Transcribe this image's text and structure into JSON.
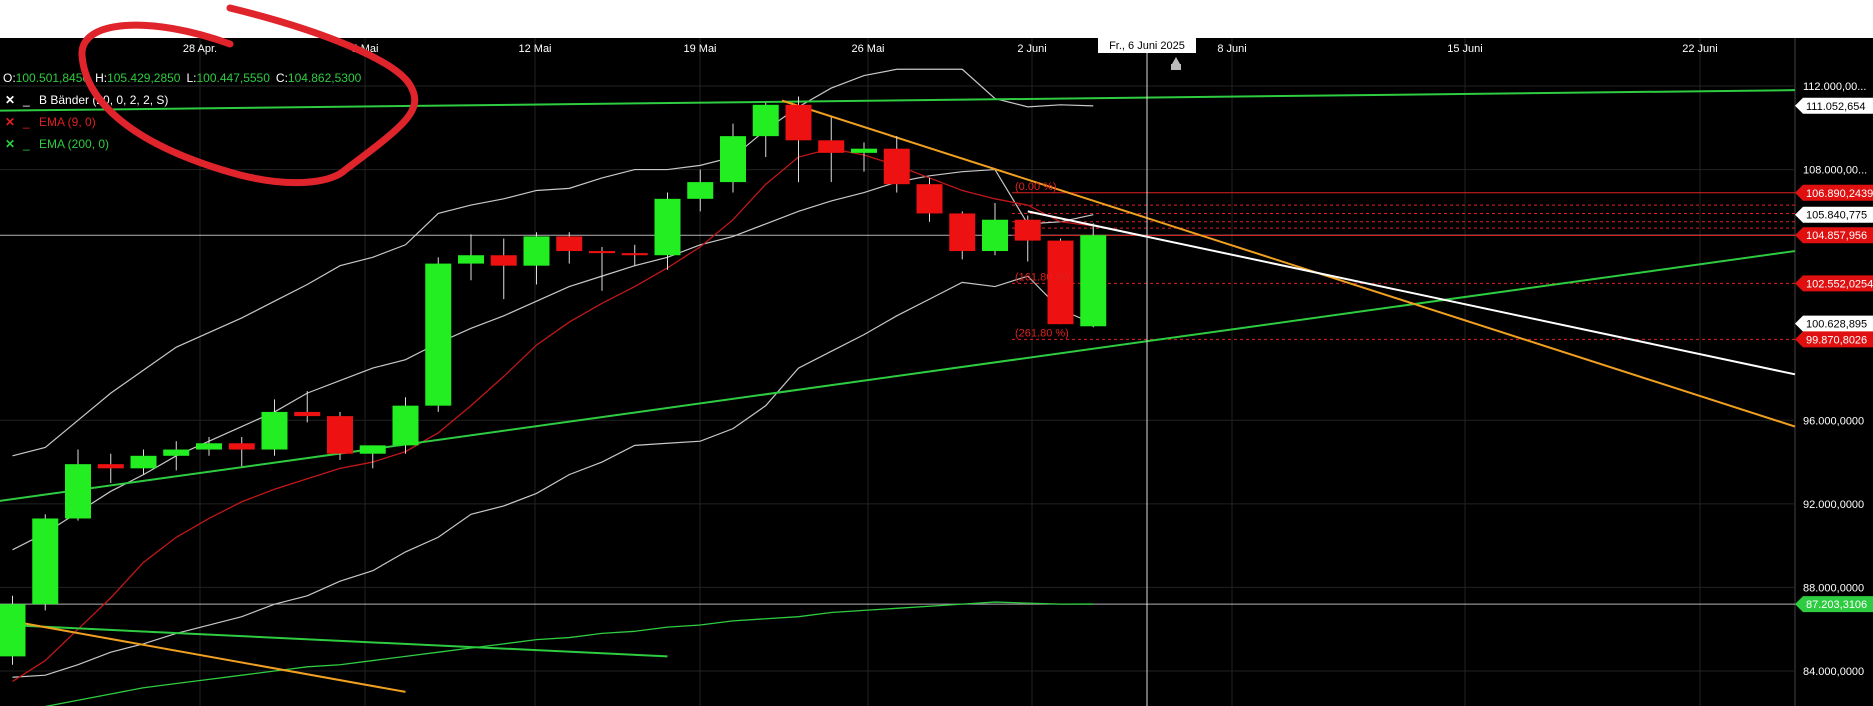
{
  "x_labels": [
    "28 Apr.",
    "5 Mai",
    "12 Mai",
    "19 Mai",
    "26 Mai",
    "2 Juni",
    "8 Juni",
    "15 Juni",
    "22 Juni"
  ],
  "crosshair_date": "Fr., 6 Juni 2025",
  "ohlc": {
    "o_label": "O:",
    "o": "100.501,8450",
    "h_label": "H:",
    "h": "105.429,2850",
    "l_label": "L:",
    "l": "100.447,5550",
    "c_label": "C:",
    "c": "104.862,5300"
  },
  "legend": [
    {
      "label": "B Bänder (20, 0, 2, 2, S)",
      "color": "#ffffff"
    },
    {
      "label": "EMA (9, 0)",
      "color": "#e02020"
    },
    {
      "label": "EMA (200, 0)",
      "color": "#2ecc40"
    }
  ],
  "y_axis": {
    "ticks": [
      "112.000,00...",
      "108.000,00...",
      "96.000,0000",
      "92.000,0000",
      "88.000,0000",
      "84.000,0000"
    ],
    "tick_values": [
      112000,
      108000,
      96000,
      92000,
      88000,
      84000
    ]
  },
  "price_tags": [
    {
      "text": "111.052,654",
      "value": 111052,
      "bg": "#ffffff",
      "fg": "#000000"
    },
    {
      "text": "106.890,2439",
      "value": 106890,
      "bg": "#e01010",
      "fg": "#ffffff"
    },
    {
      "text": "105.840,775",
      "value": 105840,
      "bg": "#ffffff",
      "fg": "#000000"
    },
    {
      "text": "104.857,956",
      "value": 104858,
      "bg": "#e01010",
      "fg": "#ffffff"
    },
    {
      "text": "102.552,0254",
      "value": 102552,
      "bg": "#e01010",
      "fg": "#ffffff"
    },
    {
      "text": "100.628,895",
      "value": 100629,
      "bg": "#ffffff",
      "fg": "#000000"
    },
    {
      "text": "99.870,8026",
      "value": 99871,
      "bg": "#e01010",
      "fg": "#ffffff"
    },
    {
      "text": "87.203,3106",
      "value": 87203,
      "bg": "#2ecc40",
      "fg": "#ffffff"
    }
  ],
  "fib_labels": [
    {
      "text": "(0.00 %)",
      "value": 106890
    },
    {
      "text": "(161.80 %)",
      "value": 102552
    },
    {
      "text": "(261.80 %)",
      "value": 99871
    }
  ],
  "chart_data": {
    "type": "candlestick",
    "x_axis": [
      "28 Apr.",
      "5 Mai",
      "12 Mai",
      "19 Mai",
      "26 Mai",
      "2 Juni",
      "8 Juni",
      "15 Juni",
      "22 Juni"
    ],
    "ylim": [
      83000,
      113000
    ],
    "candles": [
      {
        "o": 84700,
        "h": 87600,
        "l": 84300,
        "c": 87200
      },
      {
        "o": 87200,
        "h": 91500,
        "l": 86900,
        "c": 91300
      },
      {
        "o": 91300,
        "h": 94600,
        "l": 91200,
        "c": 93900
      },
      {
        "o": 93900,
        "h": 94400,
        "l": 93000,
        "c": 93700
      },
      {
        "o": 93700,
        "h": 94600,
        "l": 93400,
        "c": 94300
      },
      {
        "o": 94300,
        "h": 95000,
        "l": 93600,
        "c": 94600
      },
      {
        "o": 94600,
        "h": 95200,
        "l": 94300,
        "c": 94900
      },
      {
        "o": 94900,
        "h": 95200,
        "l": 93800,
        "c": 94600
      },
      {
        "o": 94600,
        "h": 97000,
        "l": 94300,
        "c": 96400
      },
      {
        "o": 96400,
        "h": 97400,
        "l": 95900,
        "c": 96200
      },
      {
        "o": 96200,
        "h": 96400,
        "l": 94100,
        "c": 94400
      },
      {
        "o": 94400,
        "h": 94800,
        "l": 93700,
        "c": 94800
      },
      {
        "o": 94800,
        "h": 97100,
        "l": 94400,
        "c": 96700
      },
      {
        "o": 96700,
        "h": 103800,
        "l": 96400,
        "c": 103500
      },
      {
        "o": 103500,
        "h": 104900,
        "l": 102700,
        "c": 103900
      },
      {
        "o": 103900,
        "h": 104700,
        "l": 101800,
        "c": 103400
      },
      {
        "o": 103400,
        "h": 105000,
        "l": 102500,
        "c": 104800
      },
      {
        "o": 104800,
        "h": 105000,
        "l": 103500,
        "c": 104100
      },
      {
        "o": 104100,
        "h": 104300,
        "l": 102200,
        "c": 104000
      },
      {
        "o": 104000,
        "h": 104400,
        "l": 103400,
        "c": 103900
      },
      {
        "o": 103900,
        "h": 106900,
        "l": 103200,
        "c": 106600
      },
      {
        "o": 106600,
        "h": 108000,
        "l": 106000,
        "c": 107400
      },
      {
        "o": 107400,
        "h": 110200,
        "l": 106900,
        "c": 109600
      },
      {
        "o": 109600,
        "h": 111200,
        "l": 108600,
        "c": 111100
      },
      {
        "o": 111100,
        "h": 111500,
        "l": 107400,
        "c": 109400
      },
      {
        "o": 109400,
        "h": 110500,
        "l": 107400,
        "c": 108800
      },
      {
        "o": 108800,
        "h": 109300,
        "l": 107900,
        "c": 109000
      },
      {
        "o": 109000,
        "h": 109600,
        "l": 106900,
        "c": 107300
      },
      {
        "o": 107300,
        "h": 107600,
        "l": 105500,
        "c": 105900
      },
      {
        "o": 105900,
        "h": 106000,
        "l": 103700,
        "c": 104100
      },
      {
        "o": 104100,
        "h": 106400,
        "l": 103900,
        "c": 105600
      },
      {
        "o": 105600,
        "h": 105800,
        "l": 103600,
        "c": 104600
      },
      {
        "o": 104600,
        "h": 104700,
        "l": 100600,
        "c": 100600
      },
      {
        "o": 100500,
        "h": 105430,
        "l": 100450,
        "c": 104860
      }
    ],
    "ema9": [
      83500,
      84500,
      86000,
      87500,
      89200,
      90400,
      91300,
      92100,
      92700,
      93200,
      93700,
      94000,
      94500,
      95400,
      96700,
      98100,
      99600,
      100700,
      101600,
      102400,
      103300,
      104300,
      105600,
      107300,
      108600,
      109000,
      108700,
      108200,
      107600,
      107000,
      106600,
      106300,
      105500,
      105300
    ],
    "bb_upper": [
      94300,
      94700,
      96000,
      97300,
      98400,
      99500,
      100200,
      100900,
      101700,
      102500,
      103400,
      103800,
      104400,
      105900,
      106300,
      106600,
      107000,
      107100,
      107600,
      108000,
      108000,
      108200,
      108600,
      109900,
      111000,
      111900,
      112500,
      112800,
      112800,
      112800,
      111400,
      111000,
      111100,
      111050
    ],
    "bb_middle": [
      89800,
      90600,
      91600,
      92600,
      93400,
      94300,
      95000,
      95700,
      96400,
      97300,
      97900,
      98500,
      98900,
      99700,
      100400,
      101000,
      101700,
      102400,
      102900,
      103400,
      103800,
      104400,
      104800,
      105400,
      106000,
      106500,
      106900,
      107400,
      107700,
      107900,
      108000,
      105400,
      105500,
      105840
    ],
    "bb_lower": [
      83700,
      83800,
      84300,
      84900,
      85300,
      85800,
      86200,
      86600,
      87200,
      87600,
      88300,
      88800,
      89700,
      90400,
      91500,
      91900,
      92500,
      93400,
      94000,
      94800,
      94900,
      95000,
      95600,
      96700,
      98500,
      99300,
      100100,
      101000,
      101800,
      102600,
      102400,
      102900,
      101300,
      100630
    ],
    "ema200": [
      82000,
      82300,
      82600,
      82900,
      83200,
      83400,
      83600,
      83800,
      84000,
      84200,
      84300,
      84500,
      84700,
      84900,
      85100,
      85300,
      85500,
      85600,
      85800,
      85900,
      86100,
      86200,
      86400,
      86500,
      86600,
      86800,
      86900,
      87000,
      87100,
      87200,
      87300,
      87250,
      87200,
      87203
    ],
    "horizontal_lines": [
      {
        "value": 104858,
        "color": "#ffffff"
      },
      {
        "value": 87203,
        "color": "#ffffff"
      }
    ],
    "trend_lines": [
      {
        "color": "#2ecc40",
        "from": [
          -1.5,
          110800
        ],
        "to": [
          55.5,
          111800
        ]
      },
      {
        "color": "#2ecc40",
        "from": [
          -1.5,
          91900
        ],
        "to": [
          55.5,
          104100
        ]
      },
      {
        "color": "#2ecc40",
        "from": [
          -1.5,
          86300
        ],
        "to": [
          20,
          84700
        ]
      },
      {
        "color": "#f0a020",
        "from": [
          23.5,
          111300
        ],
        "to": [
          55.5,
          95700
        ]
      },
      {
        "color": "#f0a020",
        "from": [
          -1.5,
          86800
        ],
        "to": [
          12,
          83000
        ]
      },
      {
        "color": "#ffffff",
        "from": [
          31,
          106000
        ],
        "to": [
          55.5,
          98200
        ]
      }
    ],
    "fib_levels": [
      106890,
      106300,
      105900,
      105500,
      105200,
      104850,
      102552,
      99871
    ]
  }
}
